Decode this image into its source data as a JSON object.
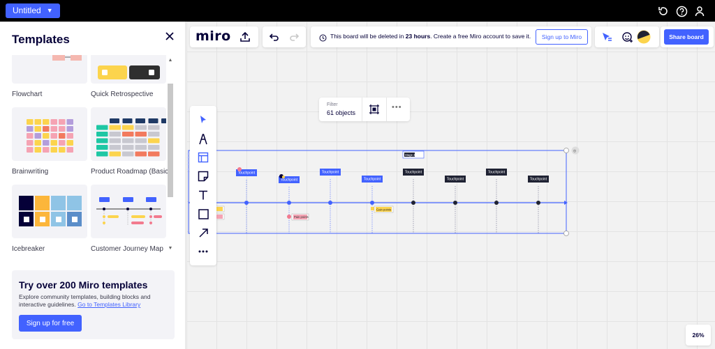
{
  "topbar": {
    "board_name": "Untitled",
    "icons": [
      "history-icon",
      "help-icon",
      "user-icon"
    ]
  },
  "sidebar": {
    "title": "Templates",
    "templates": [
      {
        "label": "Flowchart"
      },
      {
        "label": "Quick Retrospective"
      },
      {
        "label": "Brainwriting"
      },
      {
        "label": "Product Roadmap (Basic)"
      },
      {
        "label": "Icebreaker"
      },
      {
        "label": "Customer Journey Map"
      }
    ],
    "promo": {
      "title": "Try over 200 Miro templates",
      "text": "Explore community templates, building blocks and interactive guidelines.",
      "link": "Go to Templates Library",
      "button": "Sign up for free"
    }
  },
  "header": {
    "logo": "miro",
    "notice_prefix": "This board will be deleted in",
    "notice_bold": "23 hours",
    "notice_suffix": ". Create a free Miro account to save it.",
    "signup_button": "Sign up to Miro",
    "share_button": "Share board"
  },
  "filter": {
    "label": "Filter",
    "count": "61 objects"
  },
  "zoom": "26%",
  "diagram": {
    "frame_label": "Stage 3",
    "touchpoint_label": "Touchpoint",
    "notes": [
      "Gain points",
      "Pain points"
    ],
    "colors": {
      "accent": "#4262ff",
      "dark": "#1f2233",
      "yellow": "#fcd44d",
      "pink": "#f5a3b3"
    }
  }
}
